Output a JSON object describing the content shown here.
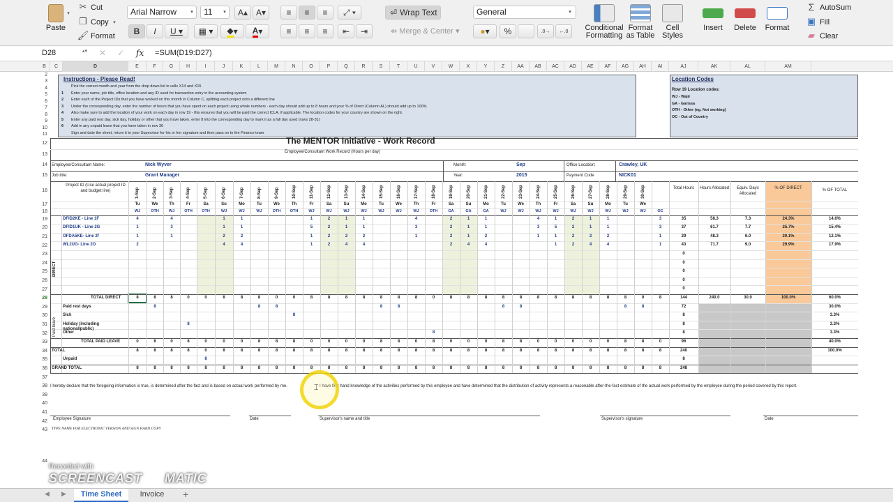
{
  "ribbon": {
    "paste": "Paste",
    "cut": "Cut",
    "copy": "Copy",
    "format": "Format",
    "font_name": "Arial Narrow",
    "font_size": "11",
    "wrap_text": "Wrap Text",
    "merge_center": "Merge & Center",
    "number_format": "General",
    "percent": "%",
    "comma": "",
    "cond_format": [
      "Conditional",
      "Formatting"
    ],
    "format_table": [
      "Format",
      "as Table"
    ],
    "cell_styles": [
      "Cell",
      "Styles"
    ],
    "insert": "Insert",
    "delete": "Delete",
    "format_cells": "Format",
    "autosum": "AutoSum",
    "fill": "Fill",
    "clear": "Clear"
  },
  "formula_bar": {
    "cell_ref": "D28",
    "fx": "fx",
    "formula": "=SUM(D19:D27)"
  },
  "columns": [
    "A",
    "B",
    "C",
    "D",
    "E",
    "F",
    "G",
    "H",
    "I",
    "J",
    "K",
    "L",
    "M",
    "N",
    "O",
    "P",
    "Q",
    "R",
    "S",
    "T",
    "U",
    "V",
    "W",
    "X",
    "Y",
    "Z",
    "AA",
    "AB",
    "AC",
    "AD",
    "AE",
    "AF",
    "AG",
    "AH",
    "AI",
    "AJ",
    "AK",
    "AL",
    "AM"
  ],
  "rows": [
    "1",
    "2",
    "3",
    "4",
    "5",
    "6",
    "7",
    "8",
    "9",
    "10",
    "11",
    "12",
    "13",
    "14",
    "15",
    "16",
    "17",
    "18",
    "19",
    "20",
    "21",
    "22",
    "23",
    "24",
    "25",
    "26",
    "27",
    "28",
    "29",
    "30",
    "31",
    "32",
    "33",
    "34",
    "35",
    "36",
    "37",
    "38",
    "39",
    "40",
    "41",
    "42",
    "43",
    "44"
  ],
  "instructions": {
    "title": "Instructions - Please Read!",
    "lines": [
      {
        "n": "",
        "t": "Pick the correct month and year from the drop down list in cells X14 and X15"
      },
      {
        "n": "1",
        "t": "Enter your name, job title, office location and any ID used for transaction entry in the accounting system"
      },
      {
        "n": "2",
        "t": "Enter each of the Project IDs that you have worked on this month in Column C, splitting each project onto a different line"
      },
      {
        "n": "3",
        "t": "Under the corresponding day, enter the number of hours that you have spent on each project using whole numbers - each day should add up to 8 hours and your % of Direct (Column AL) should add up to 100%"
      },
      {
        "n": "4",
        "t": "Also make sure to add the location of your work on each day in row 19 - this ensures that you will be paid the correct ICLA, if applicable. The location codes for your country are shown on the right."
      },
      {
        "n": "5",
        "t": "Enter any paid rest day, sick day, holiday or other that you have taken, enter 8 into the corresponding day to mark it as a full day used (rows 28-31)"
      },
      {
        "n": "6",
        "t": "Add in any unpaid leave that you have taken in row 36"
      },
      {
        "n": "",
        "t": "Sign and date the sheet, return it to your Supervisor for his or her signature and then pass on to the Finance team"
      }
    ]
  },
  "locations": {
    "title": "Location Codes",
    "subtitle": "Row 19 Location codes:",
    "items": [
      "WJ - Wajir",
      "GA - Garissa",
      "OTH - Other (eg. Not working)",
      "OC - Out of Country"
    ]
  },
  "form": {
    "title": "The MENTOR Initiative - Work Record",
    "subtitle": "Employee/Consultant Work Record (Hours per day)",
    "name_label": "Employee/Consultant  Name:",
    "name": "Nick Wyver",
    "job_label": "Job title:",
    "job": "Grant Manager",
    "month_label": "Month:",
    "month": "Sep",
    "year_label": "Year:",
    "year": "2015",
    "office_label": "Office Location:",
    "office": "Crawley, UK",
    "payment_label": "Payment Code",
    "payment": "NICK01",
    "project_id_label": "Project ID          (Use actual project ID and budget line)",
    "total_hours": "Total Hours",
    "hours_alloc": "Hours Allocated",
    "equiv_days": "Equiv. Days Allocated",
    "pct_direct": "% OF DIRECT",
    "pct_total": "% OF TOTAL"
  },
  "dates": [
    "1-Sep",
    "2-Sep",
    "3-Sep",
    "4-Sep",
    "5-Sep",
    "6-Sep",
    "7-Sep",
    "8-Sep",
    "9-Sep",
    "10-Sep",
    "11-Sep",
    "12-Sep",
    "13-Sep",
    "14-Sep",
    "15-Sep",
    "16-Sep",
    "17-Sep",
    "18-Sep",
    "19-Sep",
    "20-Sep",
    "21-Sep",
    "22-Sep",
    "23-Sep",
    "24-Sep",
    "25-Sep",
    "26-Sep",
    "27-Sep",
    "28-Sep",
    "29-Sep",
    "30-Sep"
  ],
  "weekdays": [
    "Tu",
    "We",
    "Th",
    "Fr",
    "Sa",
    "Su",
    "Mo",
    "Tu",
    "We",
    "Th",
    "Fr",
    "Sa",
    "Su",
    "Mo",
    "Tu",
    "We",
    "Th",
    "Fr",
    "Sa",
    "Su",
    "Mo",
    "Tu",
    "We",
    "Th",
    "Fr",
    "Sa",
    "Su",
    "Mo",
    "Tu",
    "We"
  ],
  "loc_codes": [
    "WJ",
    "OTH",
    "WJ",
    "OTH",
    "OTH",
    "WJ",
    "WJ",
    "WJ",
    "OTH",
    "OTH",
    "WJ",
    "WJ",
    "WJ",
    "WJ",
    "WJ",
    "WJ",
    "WJ",
    "OTH",
    "GA",
    "GA",
    "GA",
    "WJ",
    "WJ",
    "WJ",
    "WJ",
    "WJ",
    "WJ",
    "WJ",
    "WJ",
    "WJ",
    "OC"
  ],
  "direct_label": "DIRECT",
  "paid_leave_label": "Paid leave",
  "projects": [
    {
      "name": "DFID2KE - Line 1F",
      "vals": [
        "4",
        "",
        "4",
        "",
        "",
        "1",
        "1",
        "",
        "",
        "",
        "1",
        "2",
        "1",
        "1",
        "",
        "",
        "4",
        "",
        "2",
        "1",
        "1",
        "",
        "",
        "4",
        "1",
        "2",
        "1",
        "1",
        "",
        "",
        "3"
      ],
      "total": "35",
      "alloc": "58.3",
      "days": "7.3",
      "pct": "24.3%",
      "pctt": "14.6%"
    },
    {
      "name": "DFID1UK - Line 2G",
      "vals": [
        "1",
        "",
        "3",
        "",
        "",
        "1",
        "1",
        "",
        "",
        "",
        "5",
        "2",
        "1",
        "1",
        "",
        "",
        "3",
        "",
        "2",
        "1",
        "1",
        "",
        "",
        "3",
        "5",
        "2",
        "1",
        "1",
        "",
        "",
        "3"
      ],
      "total": "37",
      "alloc": "61.7",
      "days": "7.7",
      "pct": "25.7%",
      "pctt": "15.4%"
    },
    {
      "name": "OFDA5KE- Line 2f",
      "vals": [
        "1",
        "",
        "1",
        "",
        "",
        "2",
        "2",
        "",
        "",
        "",
        "1",
        "2",
        "2",
        "2",
        "",
        "",
        "1",
        "",
        "2",
        "1",
        "2",
        "",
        "",
        "1",
        "1",
        "2",
        "2",
        "2",
        "",
        "",
        "1"
      ],
      "total": "29",
      "alloc": "48.3",
      "days": "6.0",
      "pct": "20.1%",
      "pctt": "12.1%"
    },
    {
      "name": "WL2UG- Line 2O",
      "vals": [
        "2",
        "",
        "",
        "",
        "",
        "4",
        "4",
        "",
        "",
        "",
        "1",
        "2",
        "4",
        "4",
        "",
        "",
        "",
        "",
        "2",
        "4",
        "4",
        "",
        "",
        "",
        "1",
        "2",
        "4",
        "4",
        "",
        "",
        "1"
      ],
      "total": "43",
      "alloc": "71.7",
      "days": "9.0",
      "pct": "29.9%",
      "pctt": "17.9%"
    }
  ],
  "empty_totals": [
    "0",
    "0",
    "0",
    "0",
    "0"
  ],
  "total_direct": {
    "label": "TOTAL DIRECT",
    "vals": [
      "8",
      "8",
      "8",
      "0",
      "0",
      "8",
      "8",
      "8",
      "0",
      "0",
      "8",
      "8",
      "8",
      "8",
      "8",
      "8",
      "8",
      "0",
      "8",
      "8",
      "8",
      "8",
      "8",
      "8",
      "8",
      "8",
      "8",
      "8",
      "8",
      "0",
      "8"
    ],
    "total": "144",
    "alloc": "240.0",
    "days": "30.0",
    "pct": "100.0%",
    "pctt": "60.0%"
  },
  "leave": [
    {
      "name": "Paid rest days",
      "vals": [
        "",
        "8",
        "",
        "",
        "",
        "",
        "",
        "8",
        "8",
        "",
        "",
        "",
        "",
        "",
        "8",
        "8",
        "",
        "",
        "",
        "",
        "",
        "8",
        "8",
        "",
        "",
        "",
        "",
        "",
        "8",
        "8",
        ""
      ],
      "total": "72",
      "pctt": "30.0%"
    },
    {
      "name": "Sick",
      "vals": [
        "",
        "",
        "",
        "",
        "",
        "",
        "",
        "",
        "",
        "8",
        "",
        "",
        "",
        "",
        "",
        "",
        "",
        "",
        "",
        "",
        "",
        "",
        "",
        "",
        "",
        "",
        "",
        "",
        "",
        "",
        ""
      ],
      "total": "8",
      "pctt": "3.3%"
    },
    {
      "name": "Holiday (including national/public)",
      "vals": [
        "",
        "",
        "",
        "8",
        "",
        "",
        "",
        "",
        "",
        "",
        "",
        "",
        "",
        "",
        "",
        "",
        "",
        "",
        "",
        "",
        "",
        "",
        "",
        "",
        "",
        "",
        "",
        "",
        "",
        "",
        ""
      ],
      "total": "8",
      "pctt": "3.3%"
    },
    {
      "name": "Other",
      "vals": [
        "",
        "",
        "",
        "",
        "",
        "",
        "",
        "",
        "",
        "",
        "",
        "",
        "",
        "",
        "",
        "",
        "",
        "8",
        "",
        "",
        "",
        "",
        "",
        "",
        "",
        "",
        "",
        "",
        "",
        "",
        ""
      ],
      "total": "8",
      "pctt": "3.3%"
    }
  ],
  "total_paid_leave": {
    "label": "TOTAL PAID LEAVE",
    "vals": [
      "0",
      "8",
      "0",
      "8",
      "0",
      "0",
      "0",
      "8",
      "8",
      "8",
      "0",
      "0",
      "0",
      "0",
      "8",
      "8",
      "0",
      "8",
      "0",
      "0",
      "0",
      "8",
      "8",
      "0",
      "0",
      "0",
      "0",
      "0",
      "8",
      "8",
      "0"
    ],
    "total": "96",
    "pctt": "40.0%"
  },
  "total": {
    "label": "TOTAL",
    "vals": [
      "8",
      "8",
      "8",
      "8",
      "0",
      "8",
      "8",
      "8",
      "8",
      "8",
      "8",
      "8",
      "8",
      "8",
      "8",
      "8",
      "8",
      "8",
      "8",
      "8",
      "8",
      "8",
      "8",
      "8",
      "8",
      "8",
      "8",
      "8",
      "8",
      "8",
      "8"
    ],
    "total": "240",
    "pctt": "100.0%"
  },
  "unpaid": {
    "label": "Unpaid",
    "vals": [
      "",
      "",
      "",
      "",
      "8",
      "",
      "",
      "",
      "",
      "",
      "",
      "",
      "",
      "",
      "",
      "",
      "",
      "",
      "",
      "",
      "",
      "",
      "",
      "",
      "",
      "",
      "",
      "",
      "",
      "",
      ""
    ],
    "total": "8"
  },
  "grand_total": {
    "label": "GRAND TOTAL",
    "vals": [
      "8",
      "8",
      "8",
      "8",
      "8",
      "8",
      "8",
      "8",
      "8",
      "8",
      "8",
      "8",
      "8",
      "8",
      "8",
      "8",
      "8",
      "8",
      "8",
      "8",
      "8",
      "8",
      "8",
      "8",
      "8",
      "8",
      "8",
      "8",
      "8",
      "8",
      "8"
    ],
    "total": "248"
  },
  "declaration_left": "I hereby declare that the foregoing information is true, is determined after the fact and is based on actual work performed by me.",
  "declaration_right": "I have first hand knowledge of the activities performed by this employee and have determined that the distribution of activity represents a reasonable after-the-fact estimate of the actual work performed by the employee during the period covered by this report.",
  "sig": {
    "employee": "Employee Signature",
    "date1": "Date",
    "supervisor_name": "Supervisor's name and title",
    "supervisor_sig": "Supervisor's signature",
    "date2": "Date",
    "note": "TYPE NAME FOR ELECTRONIC VERSION AND SIGN HARD COPY"
  },
  "tabs": [
    "Time Sheet",
    "Invoice"
  ],
  "watermark": {
    "top": "Recorded with",
    "brand": "SCREENCAST",
    "brand2": "MATIC"
  }
}
